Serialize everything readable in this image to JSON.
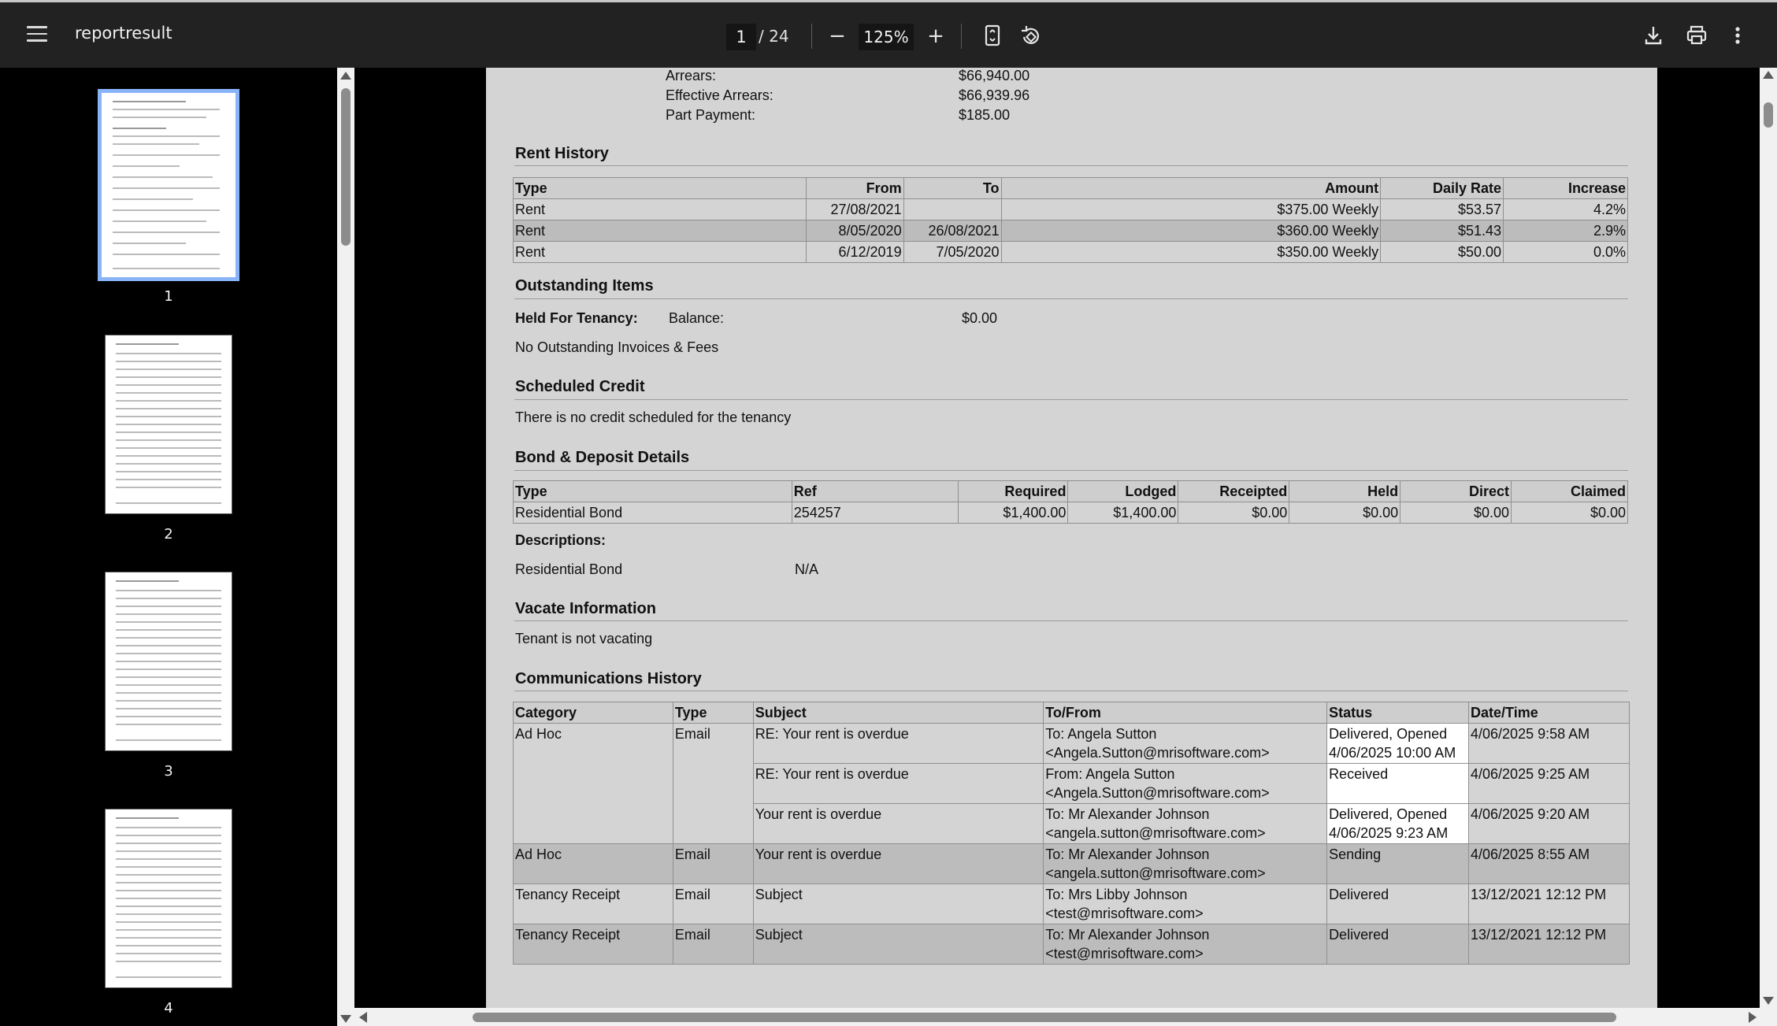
{
  "toolbar": {
    "title": "reportresult",
    "page_current": "1",
    "page_total": "/ 24",
    "zoom": "125%",
    "zoom_out_label": "−",
    "zoom_in_label": "+"
  },
  "icons": {
    "menu": "hamburger-menu-icon",
    "fit": "fit-page-icon",
    "rotate": "rotate-icon",
    "download": "download-icon",
    "print": "print-icon",
    "more": "more-vert-icon"
  },
  "colors": {
    "toolbar_bg": "#222222",
    "active_thumb_border": "#8ab4f8",
    "page_bg": "#d4d4d4"
  },
  "thumbnails": [
    {
      "label": "1"
    },
    {
      "label": "2"
    },
    {
      "label": "3"
    },
    {
      "label": "4"
    }
  ],
  "summary": {
    "rows": [
      {
        "label": "Arrears:",
        "value": "$66,940.00"
      },
      {
        "label": "Effective Arrears:",
        "value": "$66,939.96"
      },
      {
        "label": "Part Payment:",
        "value": "$185.00"
      }
    ]
  },
  "rent_history": {
    "title": "Rent History",
    "headers": [
      "Type",
      "From",
      "To",
      "Amount",
      "Daily Rate",
      "Increase"
    ],
    "rows": [
      [
        "Rent",
        "27/08/2021",
        "",
        "$375.00 Weekly",
        "$53.57",
        "4.2%"
      ],
      [
        "Rent",
        "8/05/2020",
        "26/08/2021",
        "$360.00 Weekly",
        "$51.43",
        "2.9%"
      ],
      [
        "Rent",
        "6/12/2019",
        "7/05/2020",
        "$350.00 Weekly",
        "$50.00",
        "0.0%"
      ]
    ]
  },
  "outstanding": {
    "title": "Outstanding Items",
    "held_label": "Held For Tenancy:",
    "balance_label": "Balance:",
    "balance_value": "$0.00",
    "note": "No Outstanding Invoices & Fees"
  },
  "scheduled_credit": {
    "title": "Scheduled Credit",
    "note": "There is no credit scheduled for the tenancy"
  },
  "bond": {
    "title": "Bond & Deposit Details",
    "headers": [
      "Type",
      "Ref",
      "Required",
      "Lodged",
      "Receipted",
      "Held",
      "Direct",
      "Claimed"
    ],
    "rows": [
      [
        "Residential Bond",
        "254257",
        "$1,400.00",
        "$1,400.00",
        "$0.00",
        "$0.00",
        "$0.00",
        "$0.00"
      ]
    ],
    "descriptions_label": "Descriptions:",
    "desc_type": "Residential Bond",
    "desc_value": "N/A"
  },
  "vacate": {
    "title": "Vacate Information",
    "note": "Tenant is not vacating"
  },
  "communications": {
    "title": "Communications History",
    "headers": [
      "Category",
      "Type",
      "Subject",
      "To/From",
      "Status",
      "Date/Time"
    ],
    "rows": [
      {
        "category": "Ad Hoc",
        "type": "Email",
        "subject": "RE: Your rent is overdue",
        "to1": "To: Angela Sutton",
        "to2": "<Angela.Sutton@mrisoftware.com>",
        "status1": "Delivered, Opened",
        "status2": "4/06/2025 10:00 AM",
        "datetime": "4/06/2025 9:58 AM"
      },
      {
        "category": "",
        "type": "",
        "subject": "RE: Your rent is overdue",
        "to1": "From: Angela Sutton",
        "to2": "<Angela.Sutton@mrisoftware.com>",
        "status1": "Received",
        "status2": "",
        "datetime": "4/06/2025 9:25 AM"
      },
      {
        "category": "",
        "type": "",
        "subject": "Your rent is overdue",
        "to1": "To: Mr Alexander Johnson",
        "to2": "<angela.sutton@mrisoftware.com>",
        "status1": "Delivered, Opened",
        "status2": "4/06/2025 9:23 AM",
        "datetime": "4/06/2025 9:20 AM"
      },
      {
        "category": "Ad Hoc",
        "type": "Email",
        "subject": "Your rent is overdue",
        "to1": "To: Mr Alexander Johnson",
        "to2": "<angela.sutton@mrisoftware.com>",
        "status1": "Sending",
        "status2": "",
        "datetime": "4/06/2025 8:55 AM"
      },
      {
        "category": "Tenancy Receipt",
        "type": "Email",
        "subject": "Subject",
        "to1": "To: Mrs Libby Johnson",
        "to2": "<test@mrisoftware.com>",
        "status1": "Delivered",
        "status2": "",
        "datetime": "13/12/2021 12:12 PM"
      },
      {
        "category": "Tenancy Receipt",
        "type": "Email",
        "subject": "Subject",
        "to1": "To: Mr Alexander Johnson",
        "to2": "<test@mrisoftware.com>",
        "status1": "Delivered",
        "status2": "",
        "datetime": "13/12/2021 12:12 PM"
      }
    ]
  }
}
